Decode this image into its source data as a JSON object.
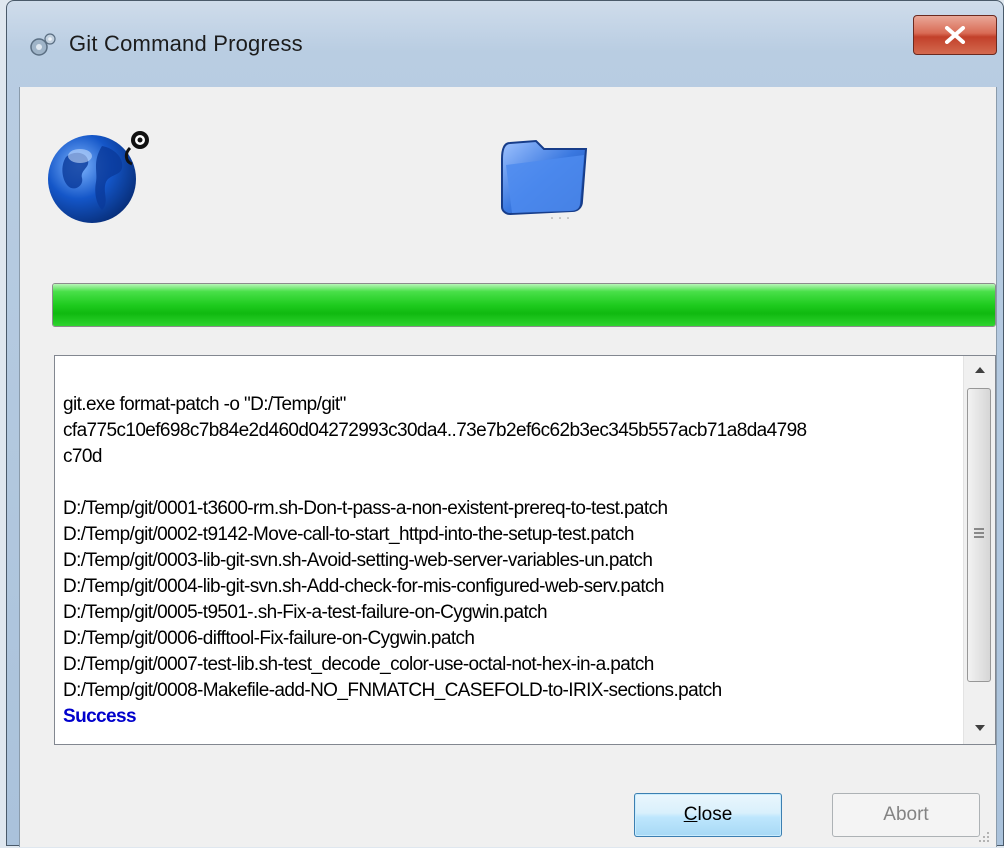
{
  "window": {
    "title": "Git Command Progress",
    "close_glyph": "×"
  },
  "icons": {
    "title": "network-gear-icon",
    "left": "globe-icon",
    "right": "folder-icon"
  },
  "progress": {
    "value": 1.0,
    "color": "#1ecb1e"
  },
  "output": {
    "command_lines": [
      "git.exe format-patch -o \"D:/Temp/git\"",
      "cfa775c10ef698c7b84e2d460d04272993c30da4..73e7b2ef6c62b3ec345b557acb71a8da4798",
      "c70d"
    ],
    "files": [
      "D:/Temp/git/0001-t3600-rm.sh-Don-t-pass-a-non-existent-prereq-to-test.patch",
      "D:/Temp/git/0002-t9142-Move-call-to-start_httpd-into-the-setup-test.patch",
      "D:/Temp/git/0003-lib-git-svn.sh-Avoid-setting-web-server-variables-un.patch",
      "D:/Temp/git/0004-lib-git-svn.sh-Add-check-for-mis-configured-web-serv.patch",
      "D:/Temp/git/0005-t9501-.sh-Fix-a-test-failure-on-Cygwin.patch",
      "D:/Temp/git/0006-difftool-Fix-failure-on-Cygwin.patch",
      "D:/Temp/git/0007-test-lib.sh-test_decode_color-use-octal-not-hex-in-a.patch",
      "D:/Temp/git/0008-Makefile-add-NO_FNMATCH_CASEFOLD-to-IRIX-sections.patch"
    ],
    "status": "Success",
    "status_color": "#0000cc"
  },
  "buttons": {
    "close_label_underlined": "C",
    "close_label_rest": "lose",
    "abort_label": "Abort"
  }
}
